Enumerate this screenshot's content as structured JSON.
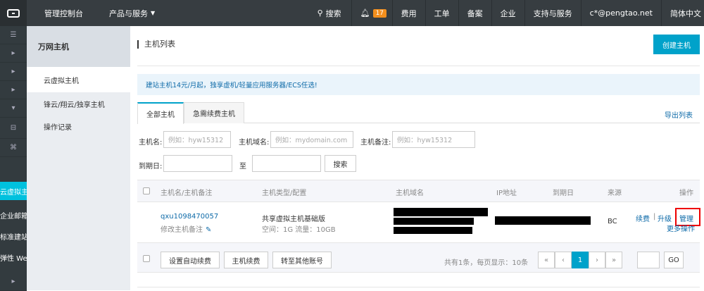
{
  "topbar": {
    "console": "管理控制台",
    "products": "产品与服务",
    "search": "搜索",
    "notif_count": "17",
    "cost": "费用",
    "ticket": "工单",
    "record": "备案",
    "enterprise": "企业",
    "support": "支持与服务",
    "account": "c*@pengtao.net",
    "lang": "简体中文"
  },
  "leftnav": {
    "active_label": "云虚拟主",
    "items": [
      "企业邮箱",
      "标准建站",
      "弹性 Web"
    ]
  },
  "subnav": {
    "title": "万网主机",
    "items": [
      "云虚拟主机",
      "锋云/翔云/独享主机",
      "操作记录"
    ]
  },
  "main": {
    "title": "主机列表",
    "create_button": "创建主机",
    "notice": "建站主机14元/月起，独享虚机/轻量应用服务器/ECS任选!",
    "tabs": [
      "全部主机",
      "急需续费主机"
    ],
    "export": "导出列表"
  },
  "filters": {
    "host_name_label": "主机名:",
    "host_name_placeholder": "例如：hyw15312",
    "domain_label": "主机域名:",
    "domain_placeholder": "例如：mydomain.com",
    "note_label": "主机备注:",
    "note_placeholder": "例如：hyw15312",
    "expire_label": "到期日:",
    "to": "至",
    "search_button": "搜索"
  },
  "table": {
    "headers": [
      "主机名/主机备注",
      "主机类型/配置",
      "主机域名",
      "IP地址",
      "到期日",
      "来源",
      "操作"
    ],
    "rows": [
      {
        "name": "qxu1098470057",
        "note_edit": "修改主机备注",
        "type": "共享虚拟主机基础版",
        "config": "空间：1G 流量：10GB",
        "source": "BC",
        "actions": [
          "续费",
          "升级",
          "管理"
        ],
        "more": "更多操作"
      }
    ]
  },
  "footer": {
    "auto_renew": "设置自动续费",
    "renew": "主机续费",
    "transfer": "转至其他账号",
    "summary": "共有1条，每页显示：10条",
    "page": "1",
    "go": "GO"
  }
}
